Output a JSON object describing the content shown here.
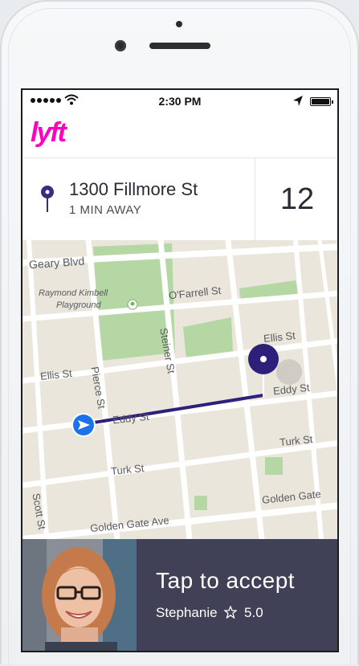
{
  "status_bar": {
    "time": "2:30 PM"
  },
  "app": {
    "logo_text": "lyft",
    "brand_color": "#ff00bf"
  },
  "destination": {
    "address": "1300 Fillmore St",
    "eta_text": "1 MIN AWAY",
    "minutes": "12"
  },
  "map": {
    "labels": {
      "geary": "Geary Blvd",
      "park": "Raymond Kimbell",
      "playground": "Playground",
      "ofarrell": "O'Farrell St",
      "ellis_left": "Ellis St",
      "ellis_right": "Ellis St",
      "eddy_left": "Eddy St",
      "eddy_right": "Eddy St",
      "pierce": "Pierce St",
      "steiner": "Steiner St",
      "turk_left": "Turk St",
      "turk_right": "Turk St",
      "scott": "Scott St",
      "golden_left": "Golden Gate Ave",
      "golden_right": "Golden Gate"
    },
    "route_color": "#2d1f7a"
  },
  "request": {
    "title": "Tap to accept",
    "passenger": "Stephanie",
    "rating": "5.0",
    "star_icon": "star-outline-icon"
  }
}
